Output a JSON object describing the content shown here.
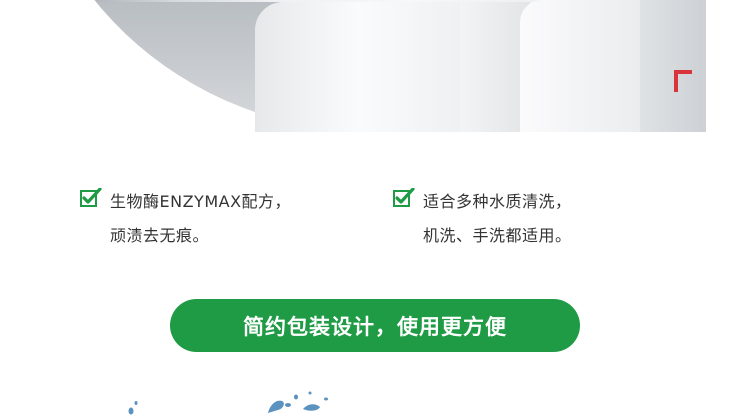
{
  "hero": {
    "image": "white-clothes-photo"
  },
  "features": [
    {
      "icon": "green-checkbox-icon",
      "line1": "生物酶ENZYMAX配方，",
      "line2": "顽渍去无痕。"
    },
    {
      "icon": "green-checkbox-icon",
      "line1": "适合多种水质清洗，",
      "line2": "机洗、手洗都适用。"
    }
  ],
  "banner": {
    "text": "简约包装设计，使用更方便"
  },
  "colors": {
    "accent_green": "#1f9a45",
    "text": "#333333",
    "hook_red": "#d8343a",
    "water": "#3f7fb5"
  }
}
